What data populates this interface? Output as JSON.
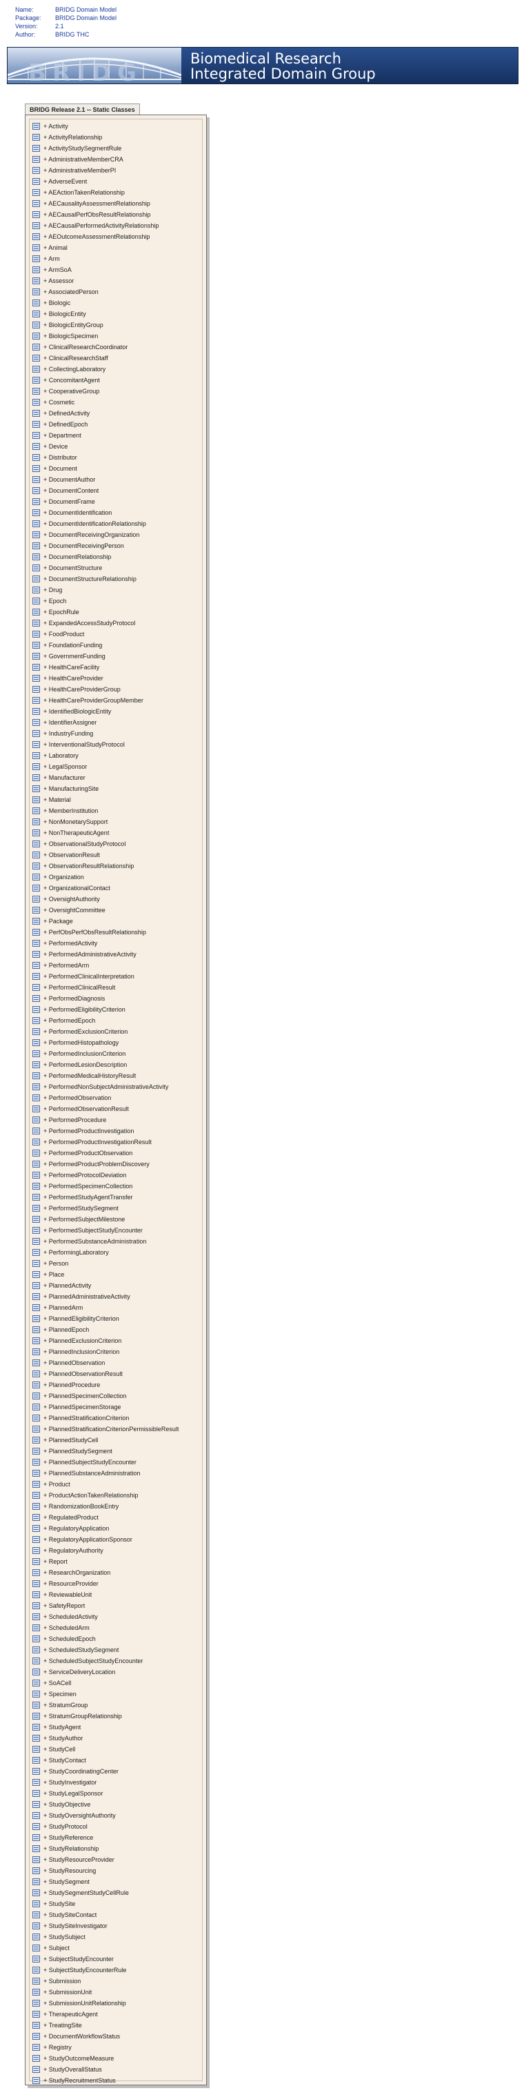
{
  "meta": {
    "rows": [
      {
        "key": "Name:",
        "value": "BRIDG Domain Model"
      },
      {
        "key": "Package:",
        "value": "BRIDG Domain Model"
      },
      {
        "key": "Version:",
        "value": "2.1"
      },
      {
        "key": "Author:",
        "value": "BRIDG THC"
      }
    ]
  },
  "banner": {
    "wordmark": "BRIDG",
    "line1": "Biomedical Research",
    "line2": "Integrated Domain Group"
  },
  "panel": {
    "tab_label": "BRIDG Release 2.1 -- Static Classes"
  },
  "classes": [
    "+ Activity",
    "+ ActivityRelationship",
    "+ ActivityStudySegmentRule",
    "+ AdministrativeMemberCRA",
    "+ AdministrativeMemberPI",
    "+ AdverseEvent",
    "+ AEActionTakenRelationship",
    "+ AECausalityAssessmentRelationship",
    "+ AECausalPerfObsResultRelationship",
    "+ AECausalPerformedActivityRelationship",
    "+ AEOutcomeAssessmentRelationship",
    "+ Animal",
    "+ Arm",
    "+ ArmSoA",
    "+ Assessor",
    "+ AssociatedPerson",
    "+ Biologic",
    "+ BiologicEntity",
    "+ BiologicEntityGroup",
    "+ BiologicSpecimen",
    "+ ClinicalResearchCoordinator",
    "+ ClinicalResearchStaff",
    "+ CollectingLaboratory",
    "+ ConcomitantAgent",
    "+ CooperativeGroup",
    "+ Cosmetic",
    "+ DefinedActivity",
    "+ DefinedEpoch",
    "+ Department",
    "+ Device",
    "+ Distributor",
    "+ Document",
    "+ DocumentAuthor",
    "+ DocumentContent",
    "+ DocumentFrame",
    "+ DocumentIdentification",
    "+ DocumentIdentificationRelationship",
    "+ DocumentReceivingOrganization",
    "+ DocumentReceivingPerson",
    "+ DocumentRelationship",
    "+ DocumentStructure",
    "+ DocumentStructureRelationship",
    "+ Drug",
    "+ Epoch",
    "+ EpochRule",
    "+ ExpandedAccessStudyProtocol",
    "+ FoodProduct",
    "+ FoundationFunding",
    "+ GovernmentFunding",
    "+ HealthCareFacility",
    "+ HealthCareProvider",
    "+ HealthCareProviderGroup",
    "+ HealthCareProviderGroupMember",
    "+ IdentifiedBiologicEntity",
    "+ IdentifierAssigner",
    "+ IndustryFunding",
    "+ InterventionalStudyProtocol",
    "+ Laboratory",
    "+ LegalSponsor",
    "+ Manufacturer",
    "+ ManufacturingSite",
    "+ Material",
    "+ MemberInstitution",
    "+ NonMonetarySupport",
    "+ NonTherapeuticAgent",
    "+ ObservationalStudyProtocol",
    "+ ObservationResult",
    "+ ObservationResultRelationship",
    "+ Organization",
    "+ OrganizationalContact",
    "+ OversightAuthority",
    "+ OversightCommittee",
    "+ Package",
    "+ PerfObsPerfObsResultRelationship",
    "+ PerformedActivity",
    "+ PerformedAdministrativeActivity",
    "+ PerformedArm",
    "+ PerformedClinicalInterpretation",
    "+ PerformedClinicalResult",
    "+ PerformedDiagnosis",
    "+ PerformedEligibilityCriterion",
    "+ PerformedEpoch",
    "+ PerformedExclusionCriterion",
    "+ PerformedHistopathology",
    "+ PerformedInclusionCriterion",
    "+ PerformedLesionDescription",
    "+ PerformedMedicalHistoryResult",
    "+ PerformedNonSubjectAdministrativeActivity",
    "+ PerformedObservation",
    "+ PerformedObservationResult",
    "+ PerformedProcedure",
    "+ PerformedProductInvestigation",
    "+ PerformedProductInvestigationResult",
    "+ PerformedProductObservation",
    "+ PerformedProductProblemDiscovery",
    "+ PerformedProtocolDeviation",
    "+ PerformedSpecimenCollection",
    "+ PerformedStudyAgentTransfer",
    "+ PerformedStudySegment",
    "+ PerformedSubjectMilestone",
    "+ PerformedSubjectStudyEncounter",
    "+ PerformedSubstanceAdministration",
    "+ PerformingLaboratory",
    "+ Person",
    "+ Place",
    "+ PlannedActivity",
    "+ PlannedAdministrativeActivity",
    "+ PlannedArm",
    "+ PlannedEligibilityCriterion",
    "+ PlannedEpoch",
    "+ PlannedExclusionCriterion",
    "+ PlannedInclusionCriterion",
    "+ PlannedObservation",
    "+ PlannedObservationResult",
    "+ PlannedProcedure",
    "+ PlannedSpecimenCollection",
    "+ PlannedSpecimenStorage",
    "+ PlannedStratificationCriterion",
    "+ PlannedStratificationCriterionPermissibleResult",
    "+ PlannedStudyCell",
    "+ PlannedStudySegment",
    "+ PlannedSubjectStudyEncounter",
    "+ PlannedSubstanceAdministration",
    "+ Product",
    "+ ProductActionTakenRelationship",
    "+ RandomizationBookEntry",
    "+ RegulatedProduct",
    "+ RegulatoryApplication",
    "+ RegulatoryApplicationSponsor",
    "+ RegulatoryAuthority",
    "+ Report",
    "+ ResearchOrganization",
    "+ ResourceProvider",
    "+ ReviewableUnit",
    "+ SafetyReport",
    "+ ScheduledActivity",
    "+ ScheduledArm",
    "+ ScheduledEpoch",
    "+ ScheduledStudySegment",
    "+ ScheduledSubjectStudyEncounter",
    "+ ServiceDeliveryLocation",
    "+ SoACell",
    "+ Specimen",
    "+ StratumGroup",
    "+ StratumGroupRelationship",
    "+ StudyAgent",
    "+ StudyAuthor",
    "+ StudyCell",
    "+ StudyContact",
    "+ StudyCoordinatingCenter",
    "+ StudyInvestigator",
    "+ StudyLegalSponsor",
    "+ StudyObjective",
    "+ StudyOversightAuthority",
    "+ StudyProtocol",
    "+ StudyReference",
    "+ StudyRelationship",
    "+ StudyResourceProvider",
    "+ StudyResourcing",
    "+ StudySegment",
    "+ StudySegmentStudyCellRule",
    "+ StudySite",
    "+ StudySiteContact",
    "+ StudySiteInvestigator",
    "+ StudySubject",
    "+ Subject",
    "+ SubjectStudyEncounter",
    "+ SubjectStudyEncounterRule",
    "+ Submission",
    "+ SubmissionUnit",
    "+ SubmissionUnitRelationship",
    "+ TherapeuticAgent",
    "+ TreatingSite",
    "+ DocumentWorkflowStatus",
    "+ Registry",
    "+ StudyOutcomeMeasure",
    "+ StudyOverallStatus",
    "+ StudyRecruitmentStatus"
  ]
}
